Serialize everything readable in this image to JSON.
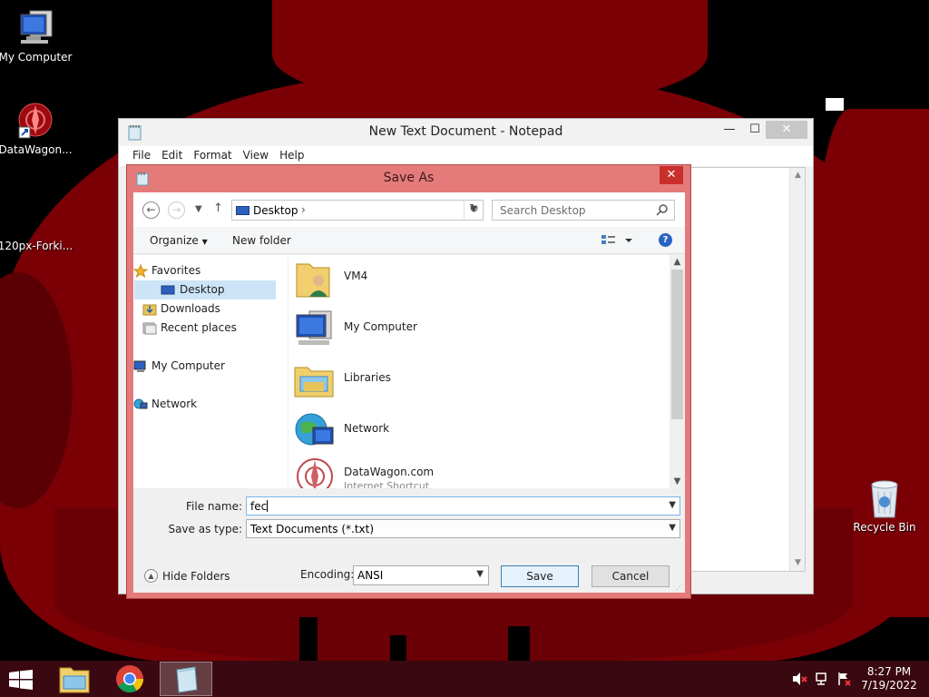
{
  "desktop": {
    "icons": [
      {
        "label": "My Computer"
      },
      {
        "label": "DataWagon..."
      },
      {
        "label": "120px-Forki..."
      },
      {
        "label": "Recycle Bin"
      }
    ]
  },
  "notepad": {
    "title": "New Text Document - Notepad",
    "menu": [
      "File",
      "Edit",
      "Format",
      "View",
      "Help"
    ],
    "controls": {
      "minimize": "—",
      "maximize": "☐",
      "close": "✕"
    }
  },
  "dialog": {
    "title": "Save As",
    "close": "✕",
    "address": {
      "location": "Desktop",
      "separator": "›"
    },
    "search": {
      "placeholder": "Search Desktop"
    },
    "toolbar": {
      "organize": "Organize",
      "new_folder": "New folder"
    },
    "nav": {
      "favorites": "Favorites",
      "desktop": "Desktop",
      "downloads": "Downloads",
      "recent": "Recent places",
      "my_computer": "My Computer",
      "network": "Network"
    },
    "files": [
      {
        "name": "VM4",
        "sub": ""
      },
      {
        "name": "My Computer",
        "sub": ""
      },
      {
        "name": "Libraries",
        "sub": ""
      },
      {
        "name": "Network",
        "sub": ""
      },
      {
        "name": "DataWagon.com",
        "sub": "Internet Shortcut"
      }
    ],
    "filename": {
      "label": "File name:",
      "value": "fec"
    },
    "filetype": {
      "label": "Save as type:",
      "value": "Text Documents (*.txt)"
    },
    "hide_folders": "Hide Folders",
    "encoding": {
      "label": "Encoding:",
      "value": "ANSI"
    },
    "save": "Save",
    "cancel": "Cancel"
  },
  "taskbar": {
    "time": "8:27 PM",
    "date": "7/19/2022"
  },
  "colors": {
    "wallpaper": "#000000",
    "blob": "#7a0006",
    "dialog_frame": "#e57a7a",
    "taskbar": "#3a0810",
    "close_red": "#c9302c"
  }
}
